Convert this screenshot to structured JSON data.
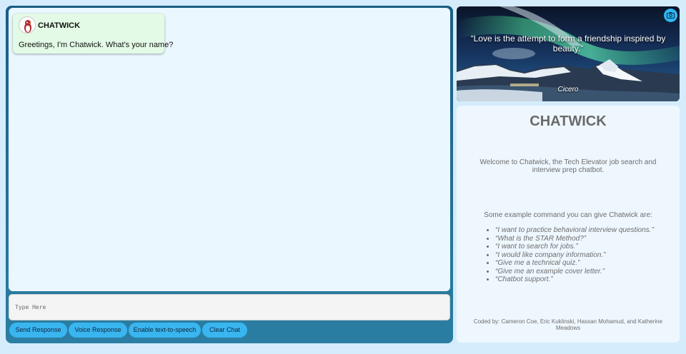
{
  "chat": {
    "messages": [
      {
        "sender": "CHATWICK",
        "text": "Greetings, I'm Chatwick. What's your name?",
        "avatar_icon": "penguin-icon"
      }
    ],
    "input_placeholder": "Type Here",
    "buttons": {
      "send": "Send Response",
      "voice": "Voice Response",
      "tts": "Enable text-to-speech",
      "clear": "Clear Chat"
    }
  },
  "quote": {
    "text": "“Love is the attempt to form a friendship inspired by beauty.”",
    "author": "Cicero",
    "camera_icon": "camera-icon"
  },
  "info": {
    "title": "CHATWICK",
    "welcome": "Welcome to Chatwick, the Tech Elevator job search and interview prep chatbot.",
    "examples_intro": "Some example command you can give Chatwick are:",
    "examples": [
      "“I want to practice behavioral interview questions.”",
      "“What is the STAR Method?”",
      "“I want to search for jobs.”",
      "“I would like company information.”",
      "“Give me a technical quiz.”",
      "“Give me an example cover letter.”",
      "“Chatbot support.”"
    ],
    "credits": "Coded by: Cameron Coe, Eric Kuklinski, Hassan Mohamud, and Katherine Meadows"
  },
  "colors": {
    "page_bg": "#d4ecfb",
    "chat_frame": "#1a5d85",
    "chat_bg": "#eaf7fe",
    "bubble_bg": "#e3fbe6",
    "button_bg": "#39b5ef",
    "info_bg": "#eef7fe"
  }
}
